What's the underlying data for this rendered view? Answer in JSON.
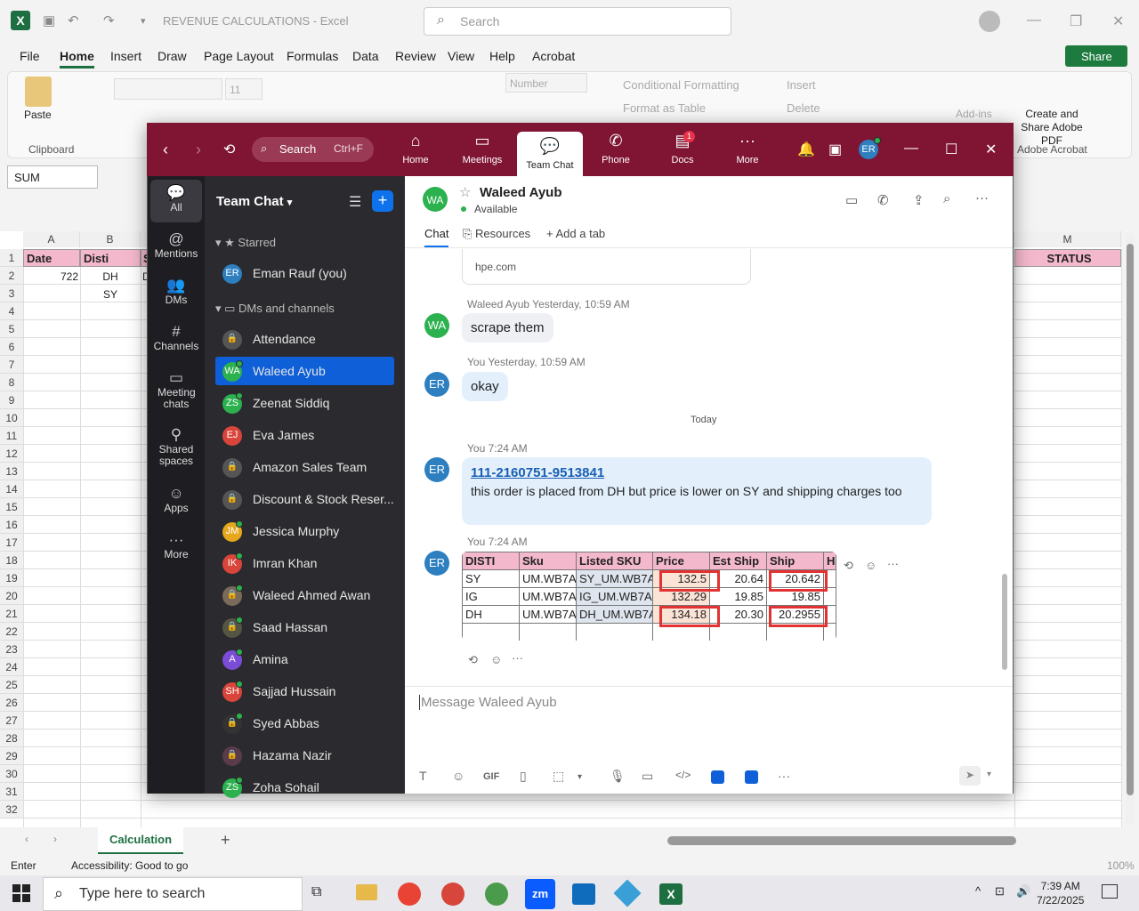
{
  "excel": {
    "doc_title": "REVENUE CALCULATIONS  -  Excel",
    "search_placeholder": "Search",
    "menu": [
      "File",
      "Home",
      "Insert",
      "Draw",
      "Page Layout",
      "Formulas",
      "Data",
      "Review",
      "View",
      "Help",
      "Acrobat"
    ],
    "share_label": "Share",
    "ribbon": {
      "paste": "Paste",
      "clipboard": "Clipboard",
      "font_size": "11",
      "number_format": "Number",
      "conditional_formatting": "Conditional Formatting",
      "format_as_table": "Format as Table",
      "insert": "Insert",
      "delete": "Delete",
      "addins": "Add-ins",
      "create_share_pdf": "Create and Share Adobe PDF",
      "adobe_acrobat": "Adobe Acrobat"
    },
    "name_box": "SUM",
    "columns": [
      "A",
      "B",
      "M"
    ],
    "header_row": {
      "date": "Date",
      "disti": "Disti",
      "s": "S",
      "status": "STATUS"
    },
    "row2": {
      "a": "722",
      "b": "DH",
      "c": "D"
    },
    "row3": {
      "b": "SY"
    },
    "rows": [
      "1",
      "2",
      "3",
      "4",
      "5",
      "6",
      "7",
      "8",
      "9",
      "10",
      "11",
      "12",
      "13",
      "14",
      "15",
      "16",
      "17",
      "18",
      "19",
      "20",
      "21",
      "22",
      "23",
      "24",
      "25",
      "26",
      "27",
      "28",
      "29",
      "30",
      "31",
      "32"
    ],
    "sheet_tab": "Calculation",
    "status_mode": "Enter",
    "accessibility": "Accessibility: Good to go",
    "zoom_level": "100%"
  },
  "taskbar": {
    "search_placeholder": "Type here to search",
    "time": "7:39 AM",
    "date": "7/22/2025"
  },
  "zoom": {
    "search_label": "Search",
    "search_shortcut": "Ctrl+F",
    "nav": [
      "Home",
      "Meetings",
      "Team Chat",
      "Phone",
      "Docs",
      "More"
    ],
    "docs_badge": "1",
    "user_initials": "ER",
    "rail": [
      "All",
      "Mentions",
      "DMs",
      "Channels",
      "Meeting chats",
      "Shared spaces",
      "Apps",
      "More"
    ],
    "list_title": "Team Chat",
    "starred_label": "Starred",
    "dms_label": "DMs and channels",
    "self": {
      "initials": "ER",
      "name": "Eman Rauf (you)"
    },
    "channels": [
      {
        "initials": "",
        "name": "Attendance"
      },
      {
        "initials": "WA",
        "name": "Waleed Ayub"
      },
      {
        "initials": "ZS",
        "name": "Zeenat Siddiq"
      },
      {
        "initials": "EJ",
        "name": "Eva James"
      },
      {
        "initials": "",
        "name": "Amazon Sales Team"
      },
      {
        "initials": "",
        "name": "Discount & Stock Reser..."
      },
      {
        "initials": "JM",
        "name": "Jessica Murphy"
      },
      {
        "initials": "IK",
        "name": "Imran Khan"
      },
      {
        "initials": "",
        "name": "Waleed Ahmed Awan"
      },
      {
        "initials": "",
        "name": "Saad Hassan"
      },
      {
        "initials": "A",
        "name": "Amina"
      },
      {
        "initials": "SH",
        "name": "Sajjad Hussain"
      },
      {
        "initials": "",
        "name": "Syed Abbas"
      },
      {
        "initials": "",
        "name": "Hazama Nazir"
      },
      {
        "initials": "ZS",
        "name": "Zoha Sohail"
      }
    ],
    "chat": {
      "contact_initials": "WA",
      "contact_name": "Waleed Ayub",
      "contact_status": "Available",
      "tabs": [
        "Chat",
        "Resources",
        "Add a tab"
      ],
      "link_preview": "hpe.com",
      "msg1_meta": "Waleed Ayub Yesterday, 10:59 AM",
      "msg1_text": "scrape them",
      "msg2_meta": "You Yesterday, 10:59 AM",
      "msg2_text": "okay",
      "divider": "Today",
      "msg3_meta": "You 7:24 AM",
      "msg3_link_a": "111-2160751",
      "msg3_link_sep": "-",
      "msg3_link_b": "9513841",
      "msg3_text": "this order is placed from DH but price is lower on SY and shipping charges too",
      "msg4_meta": "You 7:24 AM",
      "table_headers": [
        "DISTI",
        "Sku",
        "Listed SKU",
        "Price",
        "Est Ship",
        "Ship",
        "Ha"
      ],
      "table_rows": [
        [
          "SY",
          "UM.WB7A",
          "SY_UM.WB7A",
          "132.5",
          "20.64",
          "20.642"
        ],
        [
          "IG",
          "UM.WB7A",
          "IG_UM.WB7A",
          "132.29",
          "19.85",
          "19.85"
        ],
        [
          "DH",
          "UM.WB7A",
          "DH_UM.WB7A",
          "134.18",
          "20.30",
          "20.2955"
        ]
      ],
      "compose_placeholder": "Message Waleed Ayub"
    }
  }
}
